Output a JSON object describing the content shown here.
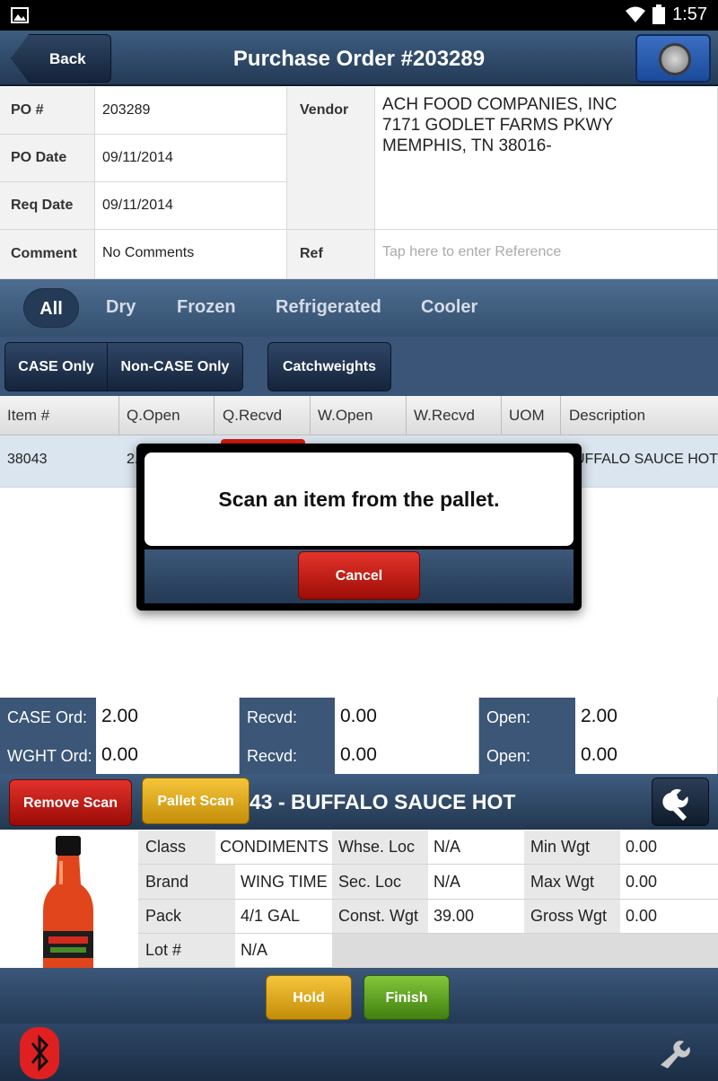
{
  "status_bar": {
    "time": "1:57"
  },
  "header": {
    "title": "Purchase Order #203289",
    "back_label": "Back"
  },
  "po_info": {
    "po_number_label": "PO #",
    "po_number": "203289",
    "po_date_label": "PO Date",
    "po_date": "09/11/2014",
    "req_date_label": "Req Date",
    "req_date": "09/11/2014",
    "comment_label": "Comment",
    "comment": "No Comments",
    "vendor_label": "Vendor",
    "vendor_line1": "ACH FOOD COMPANIES, INC",
    "vendor_line2": "7171 GODLET FARMS PKWY",
    "vendor_line3": "MEMPHIS, TN 38016-",
    "ref_label": "Ref",
    "ref_placeholder": "Tap here to enter Reference"
  },
  "tabs": [
    "All",
    "Dry",
    "Frozen",
    "Refrigerated",
    "Cooler"
  ],
  "filters": {
    "case_only": "CASE Only",
    "non_case_only": "Non-CASE Only",
    "catchweights": "Catchweights"
  },
  "table": {
    "columns": [
      "Item #",
      "Q.Open",
      "Q.Recvd",
      "W.Open",
      "W.Recvd",
      "UOM",
      "Description"
    ],
    "row": {
      "item": "38043",
      "q_open": "2.",
      "description": "UFFALO SAUCE HOT"
    }
  },
  "dialog": {
    "message": "Scan an item from the pallet.",
    "cancel_label": "Cancel"
  },
  "summary": {
    "case_ord_label": "CASE Ord:",
    "case_ord": "2.00",
    "case_recvd_label": "Recvd:",
    "case_recvd": "0.00",
    "case_open_label": "Open:",
    "case_open": "2.00",
    "wght_ord_label": "WGHT Ord:",
    "wght_ord": "0.00",
    "wght_recvd_label": "Recvd:",
    "wght_recvd": "0.00",
    "wght_open_label": "Open:",
    "wght_open": "0.00"
  },
  "item_bar": {
    "remove_label": "Remove Scan",
    "pallet_label": "Pallet Scan",
    "title": "43 - BUFFALO SAUCE HOT"
  },
  "details": {
    "class_label": "Class",
    "class": "CONDIMENTS",
    "brand_label": "Brand",
    "brand": "WING TIME",
    "pack_label": "Pack",
    "pack": "4/1 GAL",
    "lot_label": "Lot #",
    "lot": "N/A",
    "whse_loc_label": "Whse. Loc",
    "whse_loc": "N/A",
    "sec_loc_label": "Sec. Loc",
    "sec_loc": "N/A",
    "const_wgt_label": "Const. Wgt",
    "const_wgt": "39.00",
    "min_wgt_label": "Min Wgt",
    "min_wgt": "0.00",
    "max_wgt_label": "Max Wgt",
    "max_wgt": "0.00",
    "gross_wgt_label": "Gross Wgt",
    "gross_wgt": "0.00"
  },
  "actions": {
    "hold_label": "Hold",
    "finish_label": "Finish"
  },
  "colors": {
    "accent": "#2f4a6b",
    "danger": "#d01f16",
    "warning": "#e2aa1c",
    "success": "#63a825"
  }
}
